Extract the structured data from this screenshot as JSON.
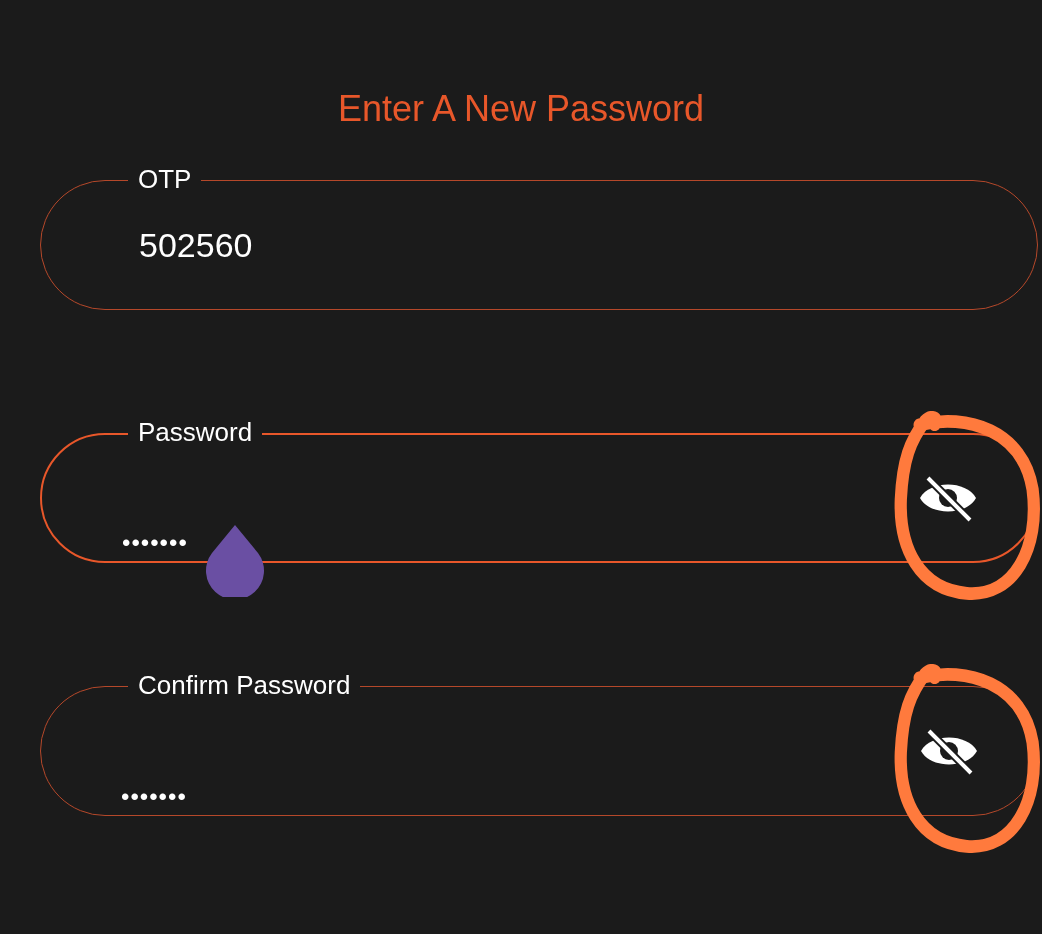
{
  "title": "Enter A New Password",
  "fields": [
    {
      "kind": "text",
      "label": "OTP",
      "value": "502560",
      "focused": false,
      "visibility_toggle": false,
      "annotated": false
    },
    {
      "kind": "password",
      "label": "Password",
      "value": "•••••••",
      "focused": true,
      "visibility_toggle": true,
      "annotated": true
    },
    {
      "kind": "password",
      "label": "Confirm Password",
      "value": "•••••••",
      "focused": false,
      "visibility_toggle": true,
      "annotated": true
    }
  ]
}
